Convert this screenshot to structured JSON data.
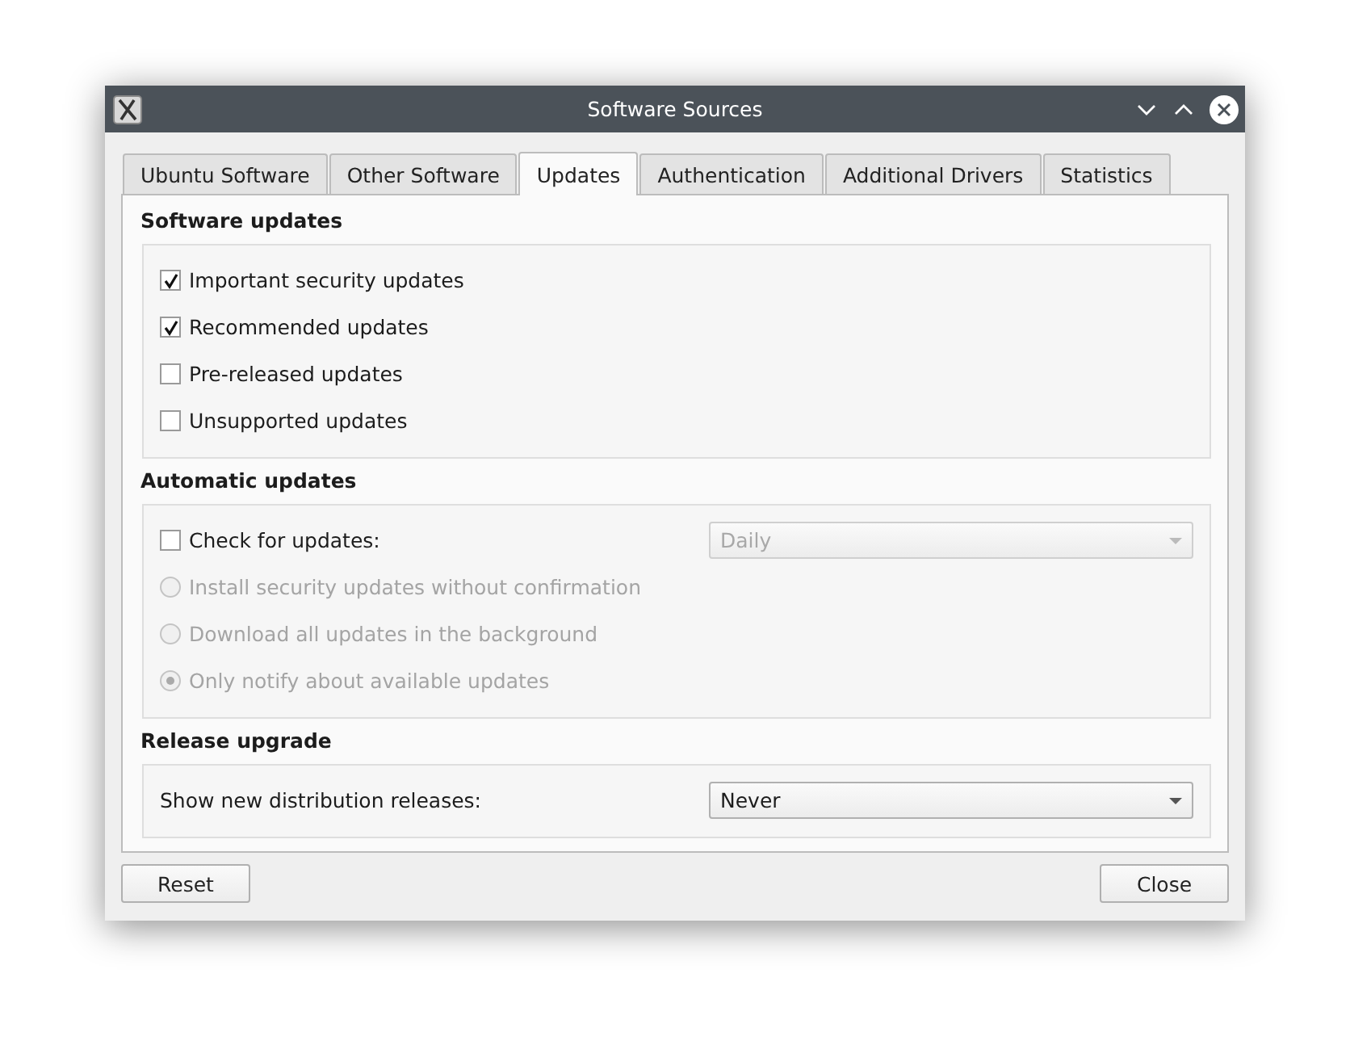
{
  "window": {
    "title": "Software Sources"
  },
  "tabs": [
    {
      "label": "Ubuntu Software",
      "selected": false
    },
    {
      "label": "Other Software",
      "selected": false
    },
    {
      "label": "Updates",
      "selected": true
    },
    {
      "label": "Authentication",
      "selected": false
    },
    {
      "label": "Additional Drivers",
      "selected": false
    },
    {
      "label": "Statistics",
      "selected": false
    }
  ],
  "sections": [
    {
      "title": "Software updates",
      "rows": [
        {
          "kind": "checkbox",
          "label": "Important security updates",
          "checked": true,
          "disabled": false
        },
        {
          "kind": "checkbox",
          "label": "Recommended updates",
          "checked": true,
          "disabled": false
        },
        {
          "kind": "checkbox",
          "label": "Pre-released updates",
          "checked": false,
          "disabled": false
        },
        {
          "kind": "checkbox",
          "label": "Unsupported updates",
          "checked": false,
          "disabled": false
        }
      ]
    },
    {
      "title": "Automatic updates",
      "rows": [
        {
          "kind": "checkbox-combo",
          "label": "Check for updates:",
          "checked": false,
          "disabled": false,
          "combo": {
            "value": "Daily",
            "disabled": true
          }
        },
        {
          "kind": "radio",
          "label": "Install security updates without confirmation",
          "selected": false,
          "disabled": true
        },
        {
          "kind": "radio",
          "label": "Download all updates in the background",
          "selected": false,
          "disabled": true
        },
        {
          "kind": "radio",
          "label": "Only notify about available updates",
          "selected": true,
          "disabled": true
        }
      ]
    },
    {
      "title": "Release upgrade",
      "rows": [
        {
          "kind": "label-combo",
          "label": "Show new distribution releases:",
          "combo": {
            "value": "Never",
            "disabled": false
          }
        }
      ]
    }
  ],
  "buttons": [
    {
      "label": "Reset"
    },
    {
      "label": "Close"
    }
  ]
}
